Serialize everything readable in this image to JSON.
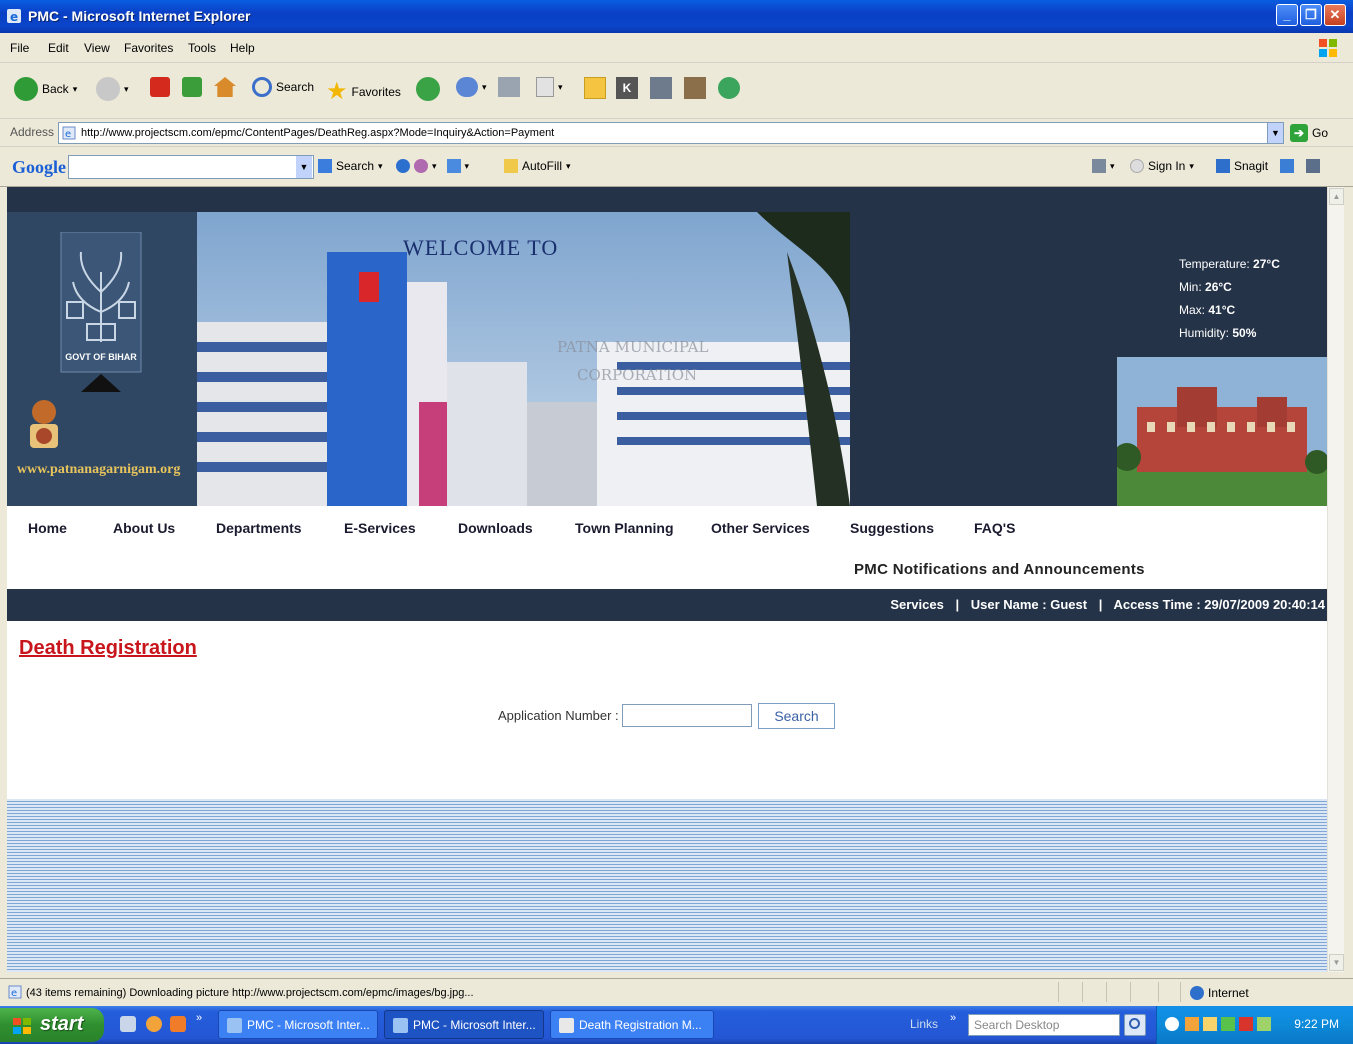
{
  "window": {
    "title": "PMC - Microsoft Internet Explorer",
    "buttons": [
      "_",
      "▫",
      "X"
    ]
  },
  "menu": [
    "File",
    "Edit",
    "View",
    "Favorites",
    "Tools",
    "Help"
  ],
  "toolbar": {
    "back": "Back",
    "search": "Search",
    "favorites": "Favorites"
  },
  "address": {
    "label": "Address",
    "url": "http://www.projectscm.com/epmc/ContentPages/DeathReg.aspx?Mode=Inquiry&Action=Payment",
    "go": "Go"
  },
  "google_bar": {
    "logo": "Google",
    "search": "Search",
    "autofill": "AutoFill",
    "sign_in": "Sign In",
    "snagit": "Snagit"
  },
  "banner": {
    "govt": "GOVT OF BIHAR",
    "site_url": "www.patnanagarnigam.org",
    "welcome": "WELCOME TO",
    "weather": {
      "temperature_label": "Temperature:",
      "temperature": "27°C",
      "min_label": "Min:",
      "min": "26°C",
      "max_label": "Max:",
      "max": "41°C",
      "humidity_label": "Humidity:",
      "humidity": "50%"
    }
  },
  "nav": [
    "Home",
    "About Us",
    "Departments",
    "E-Services",
    "Downloads",
    "Town Planning",
    "Other Services",
    "Suggestions",
    "FAQ'S"
  ],
  "announcement": "PMC Notifications and Announcements",
  "infobar": {
    "services": "Services",
    "user": "User Name : Guest",
    "access": "Access Time : 29/07/2009 20:40:14",
    "separator": "|"
  },
  "page": {
    "title": "Death Registration",
    "app_number_label": "Application Number :",
    "app_number_value": "",
    "search_button": "Search"
  },
  "status": {
    "message": "(43 items remaining) Downloading picture http://www.projectscm.com/epmc/images/bg.jpg...",
    "zone": "Internet"
  },
  "taskbar": {
    "start": "start",
    "tasks": [
      "PMC - Microsoft Inter...",
      "PMC - Microsoft Inter...",
      "Death Registration M..."
    ],
    "links": "Links",
    "search_placeholder": "Search Desktop",
    "clock": "9:22 PM"
  },
  "colors": {
    "title_bar": "#0a3fc6",
    "banner_dark": "#243347",
    "page_title": "#c8151b",
    "taskbar": "#245edb",
    "start": "#2f8f2f"
  }
}
